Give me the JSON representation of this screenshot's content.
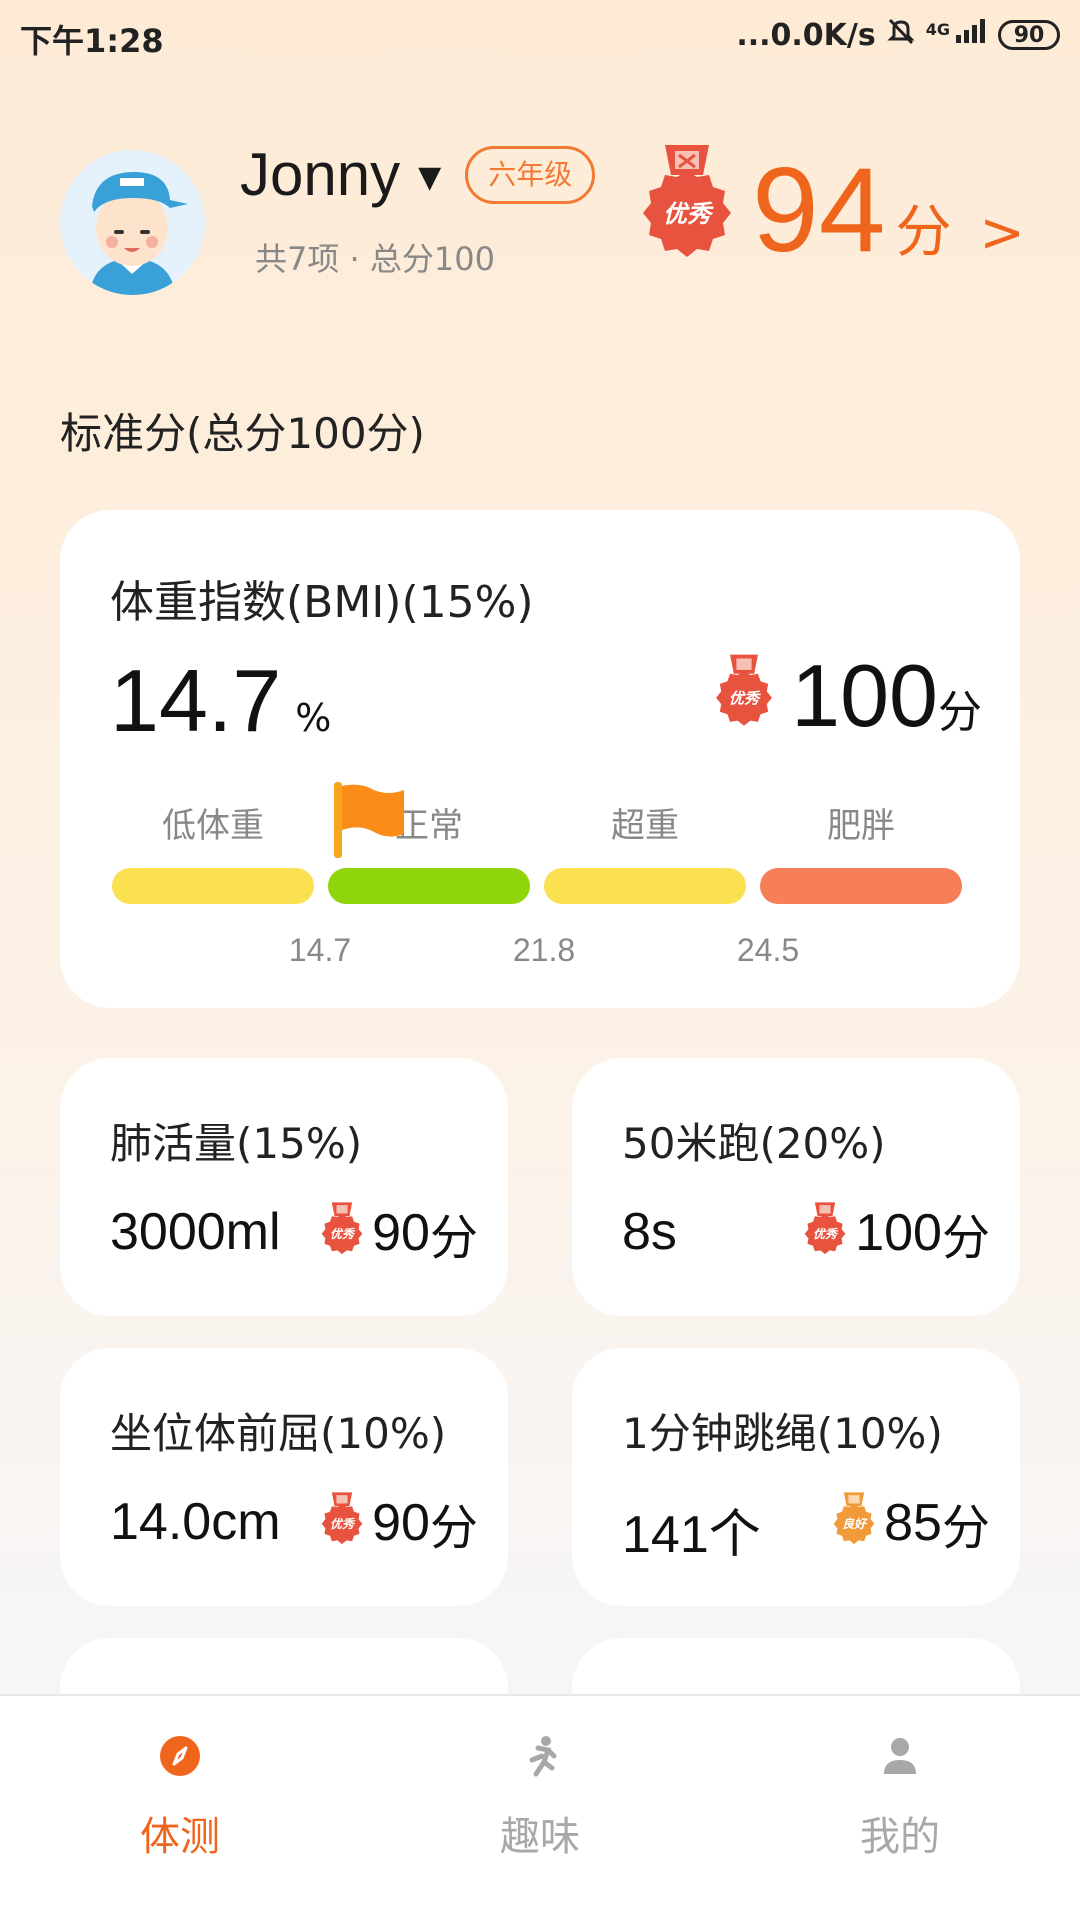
{
  "status_bar": {
    "time": "下午1:28",
    "net_speed": "...0.0K/s",
    "battery": "90",
    "network": "4G"
  },
  "user": {
    "name": "Jonny",
    "grade": "六年级",
    "summary": "共7项 · 总分100"
  },
  "total_score": {
    "value": "94",
    "unit": "分",
    "arrow": ">",
    "medal": "优秀"
  },
  "section_title": "标准分(总分100分)",
  "bmi": {
    "title": "体重指数(BMI)(15%)",
    "value": "14.7",
    "unit": "%",
    "score": "100",
    "score_unit": "分",
    "medal": "优秀",
    "scale_labels": [
      "低体重",
      "正常",
      "超重",
      "肥胖"
    ],
    "scale_ticks": [
      "14.7",
      "21.8",
      "24.5"
    ],
    "scale_colors": [
      "#fbe052",
      "#8ed60b",
      "#fbe052",
      "#f77f57"
    ]
  },
  "items": [
    {
      "title": "肺活量(15%)",
      "value": "3000ml",
      "score": "90",
      "unit": "分",
      "medal": "优秀"
    },
    {
      "title": "50米跑(20%)",
      "value": "8s",
      "score": "100",
      "unit": "分",
      "medal": "优秀"
    },
    {
      "title": "坐位体前屈(10%)",
      "value": "14.0cm",
      "score": "90",
      "unit": "分",
      "medal": "优秀"
    },
    {
      "title": "1分钟跳绳(10%)",
      "value": "141个",
      "score": "85",
      "unit": "分",
      "medal": "良好"
    }
  ],
  "tabs": [
    {
      "label": "体测",
      "icon": "compass-icon",
      "active": true
    },
    {
      "label": "趣味",
      "icon": "running-icon",
      "active": false
    },
    {
      "label": "我的",
      "icon": "person-icon",
      "active": false
    }
  ],
  "colors": {
    "accent": "#f0651c",
    "medal_red": "#e8533f",
    "medal_orange": "#f19a3a",
    "inactive_tab": "#a8a8a8"
  }
}
